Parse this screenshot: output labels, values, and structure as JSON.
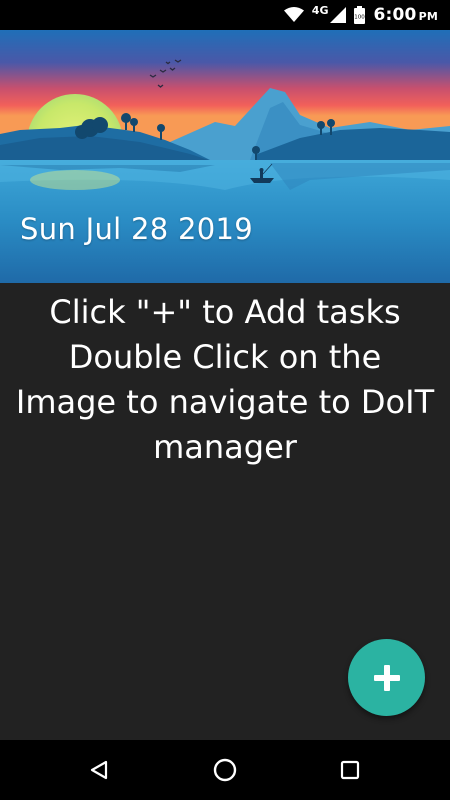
{
  "status_bar": {
    "network_label": "4G",
    "battery_level": "100",
    "time": "6:00",
    "time_suffix": "PM",
    "icons": [
      "wifi-icon",
      "signal-icon",
      "battery-icon"
    ]
  },
  "header": {
    "date": "Sun Jul 28 2019",
    "image": "landscape-sunset-lake"
  },
  "main": {
    "instructions": [
      "Click \"+\" to Add tasks",
      "Double Click on the",
      "Image to navigate to DoIT",
      "manager"
    ]
  },
  "fab": {
    "icon": "plus-icon",
    "color": "#2bb3a2"
  },
  "nav_bar": {
    "buttons": [
      "back-icon",
      "home-icon",
      "recents-icon"
    ]
  },
  "colors": {
    "background": "#222222",
    "accent": "#2bb3a2",
    "bars": "#000000"
  }
}
